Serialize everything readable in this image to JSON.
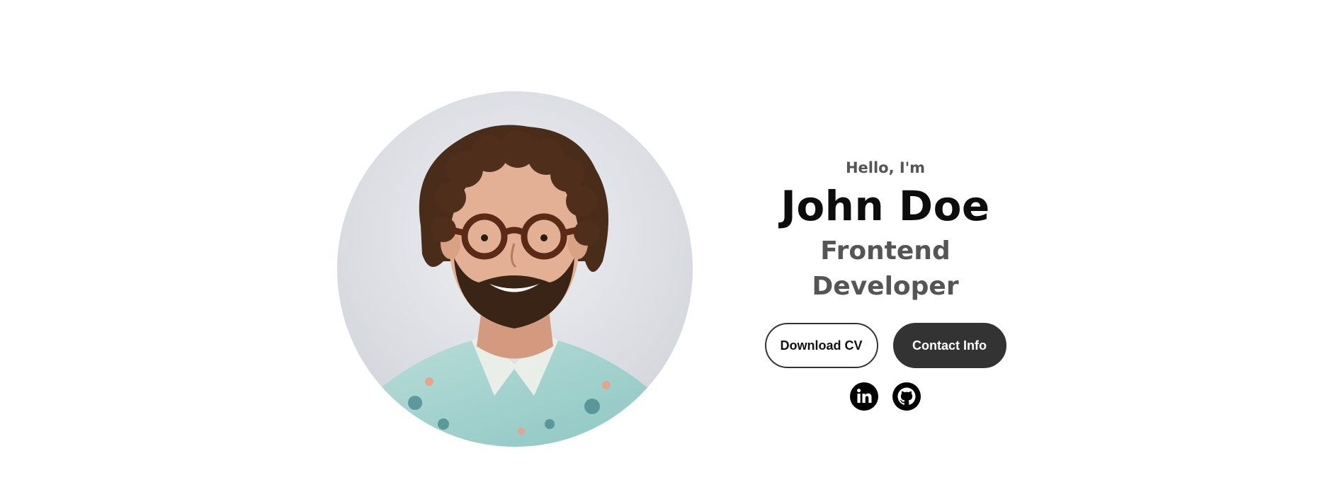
{
  "profile": {
    "greeting": "Hello, I'm",
    "name": "John Doe",
    "title": "Frontend Developer",
    "image_alt": "John Doe profile picture"
  },
  "buttons": {
    "download_cv": "Download CV",
    "contact_info": "Contact Info"
  },
  "social": [
    {
      "name": "LinkedIn",
      "icon": "linkedin-icon"
    },
    {
      "name": "GitHub",
      "icon": "github-icon"
    }
  ],
  "colors": {
    "text_dark": "#0d0d0d",
    "text_muted": "#555555",
    "button_dark": "#333333",
    "background": "#ffffff"
  }
}
